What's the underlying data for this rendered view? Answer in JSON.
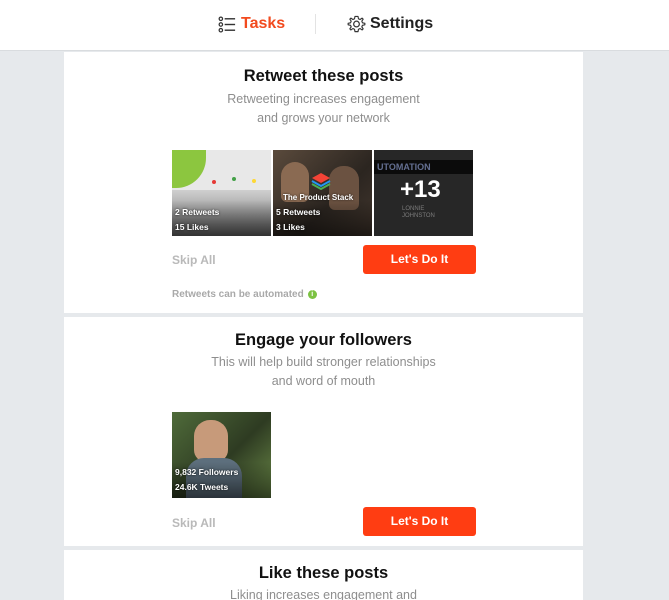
{
  "nav": {
    "tabs": [
      {
        "label": "Tasks",
        "icon": "list-icon",
        "active": true
      },
      {
        "label": "Settings",
        "icon": "gear-icon",
        "active": false
      }
    ]
  },
  "cards": [
    {
      "title": "Retweet these posts",
      "subtitle_line1": "Retweeting increases engagement",
      "subtitle_line2": "and grows your network",
      "thumbnails": [
        {
          "stat1": "2 Retweets",
          "stat2": "15 Likes"
        },
        {
          "caption": "The Product Stack",
          "stat1": "5 Retweets",
          "stat2": "3 Likes"
        },
        {
          "overlay_count": "+13",
          "bg_text1": "UTOMATION",
          "bg_text2": "LONNIE",
          "bg_text3": "JOHNSTON"
        }
      ],
      "skip_label": "Skip All",
      "cta_label": "Let's Do It",
      "note": "Retweets can be automated",
      "note_icon": "info-icon"
    },
    {
      "title": "Engage your followers",
      "subtitle_line1": "This will help build stronger relationships",
      "subtitle_line2": "and word of mouth",
      "thumbnails": [
        {
          "stat1": "9,832 Followers",
          "stat2": "24.6K Tweets"
        }
      ],
      "skip_label": "Skip All",
      "cta_label": "Let's Do It"
    },
    {
      "title": "Like these posts",
      "subtitle_line1": "Liking increases engagement and"
    }
  ],
  "colors": {
    "accent": "#f24a1e",
    "cta": "#ff3d12",
    "info": "#7cc242"
  }
}
